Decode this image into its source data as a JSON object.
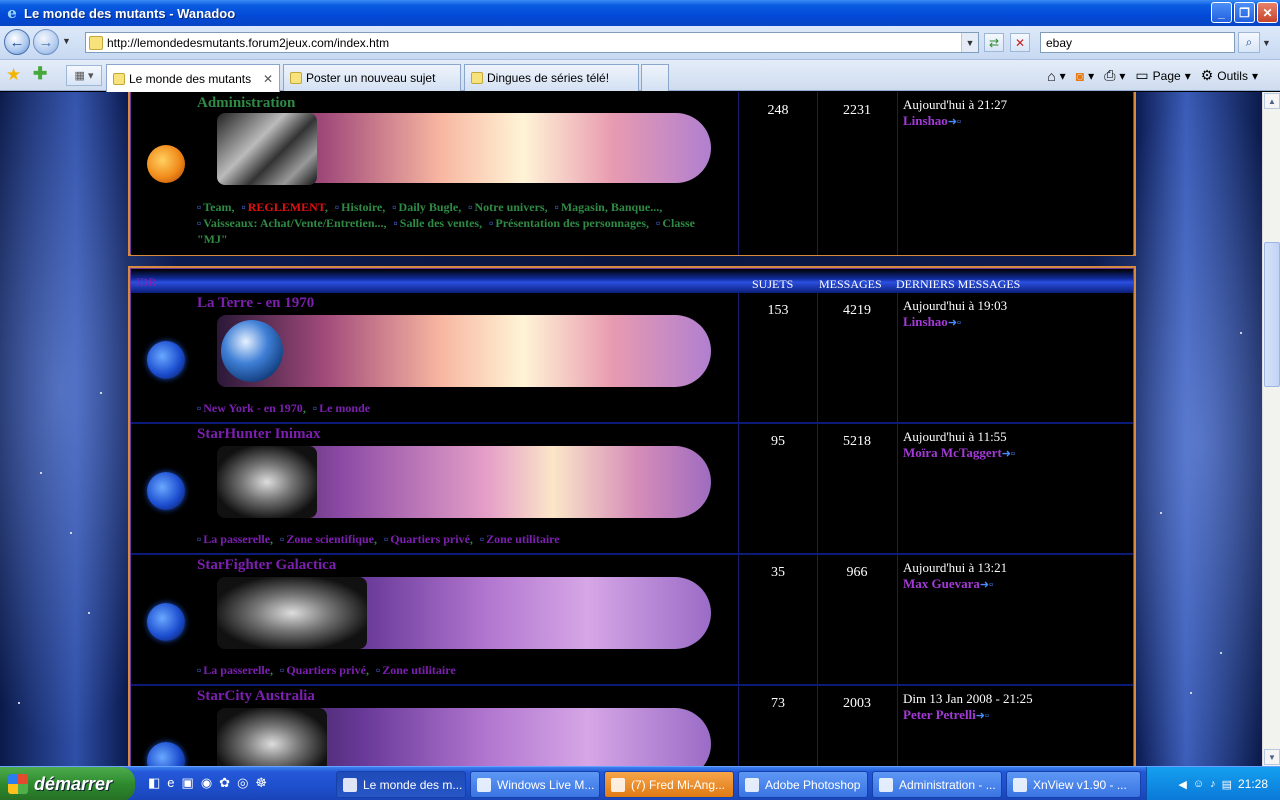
{
  "window": {
    "title": "Le monde des mutants - Wanadoo",
    "min": "_",
    "max": "❐",
    "close": "✕"
  },
  "navbar": {
    "back": "←",
    "forward": "→",
    "url": "http://lemondedesmutants.forum2jeux.com/index.htm",
    "search_value": "ebay"
  },
  "tabs": [
    {
      "label": "Le monde des mutants",
      "active": true
    },
    {
      "label": "Poster un nouveau sujet",
      "active": false
    },
    {
      "label": "Dingues de séries télé!",
      "active": false
    }
  ],
  "commandbar": {
    "page": "Page",
    "tools": "Outils"
  },
  "forum": {
    "admin_forum": {
      "name": "Administration",
      "topics": "248",
      "posts": "2231",
      "last_time": "Aujourd'hui à 21:27",
      "last_user": "Linshao",
      "subforums": [
        "Team",
        "REGLEMENT",
        "Histoire",
        "Daily Bugle",
        "Notre univers",
        "Magasin, Banque...",
        "Vaisseaux: Achat/Vente/Entretien...",
        "Salle des ventes",
        "Présentation des personnages",
        "Classe \"MJ\""
      ]
    },
    "category": {
      "name": "JDR",
      "col_topics": "SUJETS",
      "col_posts": "MESSAGES",
      "col_last": "DERNIERS MESSAGES"
    },
    "rows": [
      {
        "name": "La Terre - en 1970",
        "topics": "153",
        "posts": "4219",
        "last_time": "Aujourd'hui à 19:03",
        "last_user": "Linshao",
        "subforums": [
          "New York - en 1970",
          "Le monde"
        ]
      },
      {
        "name": "StarHunter Inimax",
        "topics": "95",
        "posts": "5218",
        "last_time": "Aujourd'hui à 11:55",
        "last_user": "Moïra McTaggert",
        "subforums": [
          "La passerelle",
          "Zone scientifique",
          "Quartiers privé",
          "Zone utilitaire"
        ]
      },
      {
        "name": "StarFighter Galactica",
        "topics": "35",
        "posts": "966",
        "last_time": "Aujourd'hui à 13:21",
        "last_user": "Max Guevara",
        "subforums": [
          "La passerelle",
          "Quartiers privé",
          "Zone utilitaire"
        ]
      },
      {
        "name": "StarCity Australia",
        "topics": "73",
        "posts": "2003",
        "last_time": "Dim 13 Jan 2008 - 21:25",
        "last_user": "Peter Petrelli",
        "subforums": []
      }
    ]
  },
  "taskbar": {
    "start": "démarrer",
    "buttons": [
      {
        "label": "Le monde des m...",
        "state": "active"
      },
      {
        "label": "Windows Live M...",
        "state": "normal"
      },
      {
        "label": "(7) Fred Mi-Ang...",
        "state": "flash"
      },
      {
        "label": "Adobe Photoshop",
        "state": "normal"
      },
      {
        "label": "Administration - ...",
        "state": "normal"
      },
      {
        "label": "XnView v1.90 - ...",
        "state": "normal"
      }
    ],
    "clock": "21:28"
  },
  "colors": {
    "titlebar": "#0a5ce0",
    "forum_border": "#d88a3c",
    "forum_link_purple": "#7c1fb0",
    "admin_green": "#2f8a45",
    "rule_red": "#e01010",
    "start_green": "#2e8a2e"
  }
}
